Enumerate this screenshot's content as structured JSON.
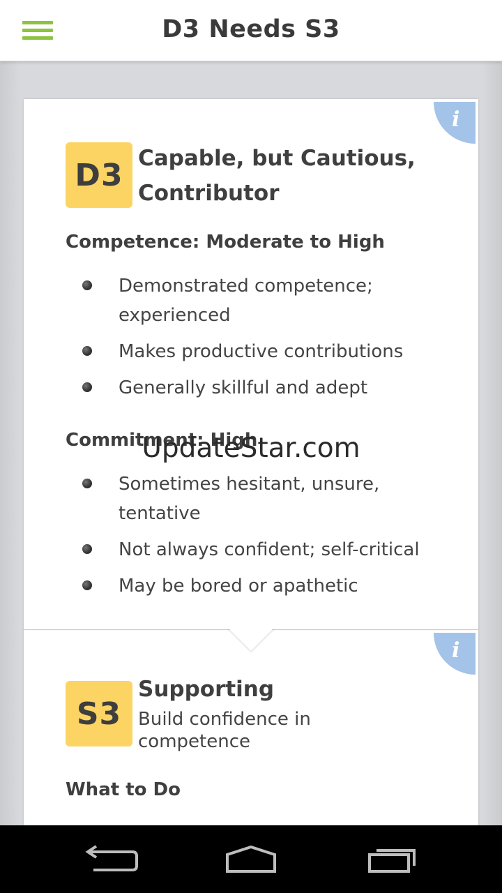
{
  "header": {
    "title": "D3 Needs S3",
    "menu_icon": "hamburger-menu-icon",
    "accent_color": "#8cc43f"
  },
  "d3_card": {
    "badge": "D3",
    "title_line1": "Capable, but Cautious,",
    "title_line2": "Contributor",
    "competence": {
      "title": "Competence: Moderate to High",
      "items": [
        {
          "line1": "Demonstrated competence;",
          "line2": "experienced"
        },
        {
          "line1": "Makes productive contributions"
        },
        {
          "line1": "Generally skillful and adept"
        }
      ]
    },
    "commitment": {
      "title": "Commitment: High",
      "items": [
        {
          "line1": "Sometimes hesitant, unsure,",
          "line2": "tentative"
        },
        {
          "line1": "Not always confident; self-critical"
        },
        {
          "line1": "May be bored or apathetic"
        }
      ]
    },
    "info_icon": "info-icon"
  },
  "s3_card": {
    "badge": "S3",
    "title": "Supporting",
    "subtitle_line1": "Build confidence in",
    "subtitle_line2": "competence",
    "section_title": "What to Do",
    "info_icon": "info-icon"
  },
  "watermark": "UpdateStar.com",
  "navbar": {
    "back_icon": "back-icon",
    "home_icon": "home-icon",
    "recent_apps_icon": "recent-apps-icon"
  },
  "colors": {
    "badge_yellow": "#fcd463",
    "info_blue": "#a4c3e8"
  }
}
